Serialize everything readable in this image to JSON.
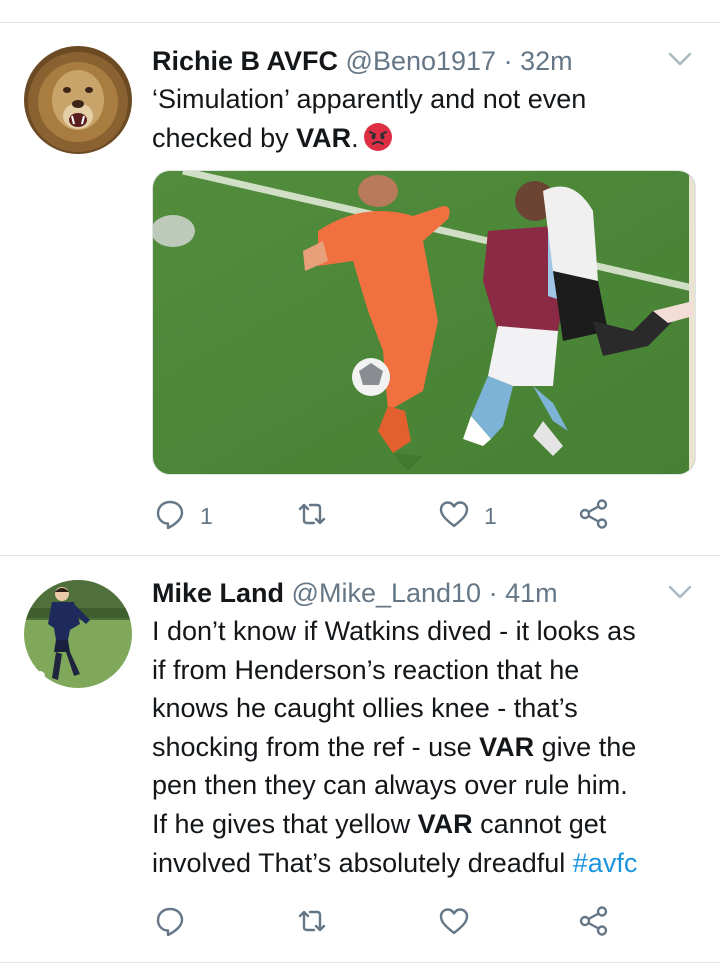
{
  "tweets": [
    {
      "author_name": "Richie B AVFC",
      "handle": "@Beno1917",
      "separator": "·",
      "time": "32m",
      "avatar_icon": "lion-avatar",
      "body": {
        "line1": "‘Simulation’ apparently and not even",
        "line2_pre": "checked by ",
        "line2_bold": "VAR",
        "line2_post": ".",
        "emoji": "angry-face-emoji"
      },
      "media_description_icon": "football-match-photo",
      "actions": {
        "reply_count": "1",
        "retweet_count": "",
        "like_count": "1"
      }
    },
    {
      "author_name": "Mike Land",
      "handle": "@Mike_Land10",
      "separator": "·",
      "time": "41m",
      "avatar_icon": "footballer-avatar",
      "body": {
        "l1": "I don’t know if Watkins dived - it looks as",
        "l2": "if from Henderson’s reaction that he",
        "l3": "knows he caught ollies knee - that’s",
        "l4_pre": "shocking from the ref - use ",
        "l4_bold": "VAR",
        "l4_post": " give the",
        "l5": "pen then they can always over rule him.",
        "l6_pre": "If he gives that yellow ",
        "l6_bold": "VAR",
        "l6_post": " cannot get",
        "l7_pre": "involved That’s absolutely dreadful ",
        "l7_hashtag": "#avfc"
      },
      "actions": {
        "reply_count": "",
        "retweet_count": "",
        "like_count": ""
      }
    }
  ],
  "colors": {
    "accent": "#1b95e0",
    "secondary_text": "#657786",
    "divider": "#e1e8ed"
  }
}
